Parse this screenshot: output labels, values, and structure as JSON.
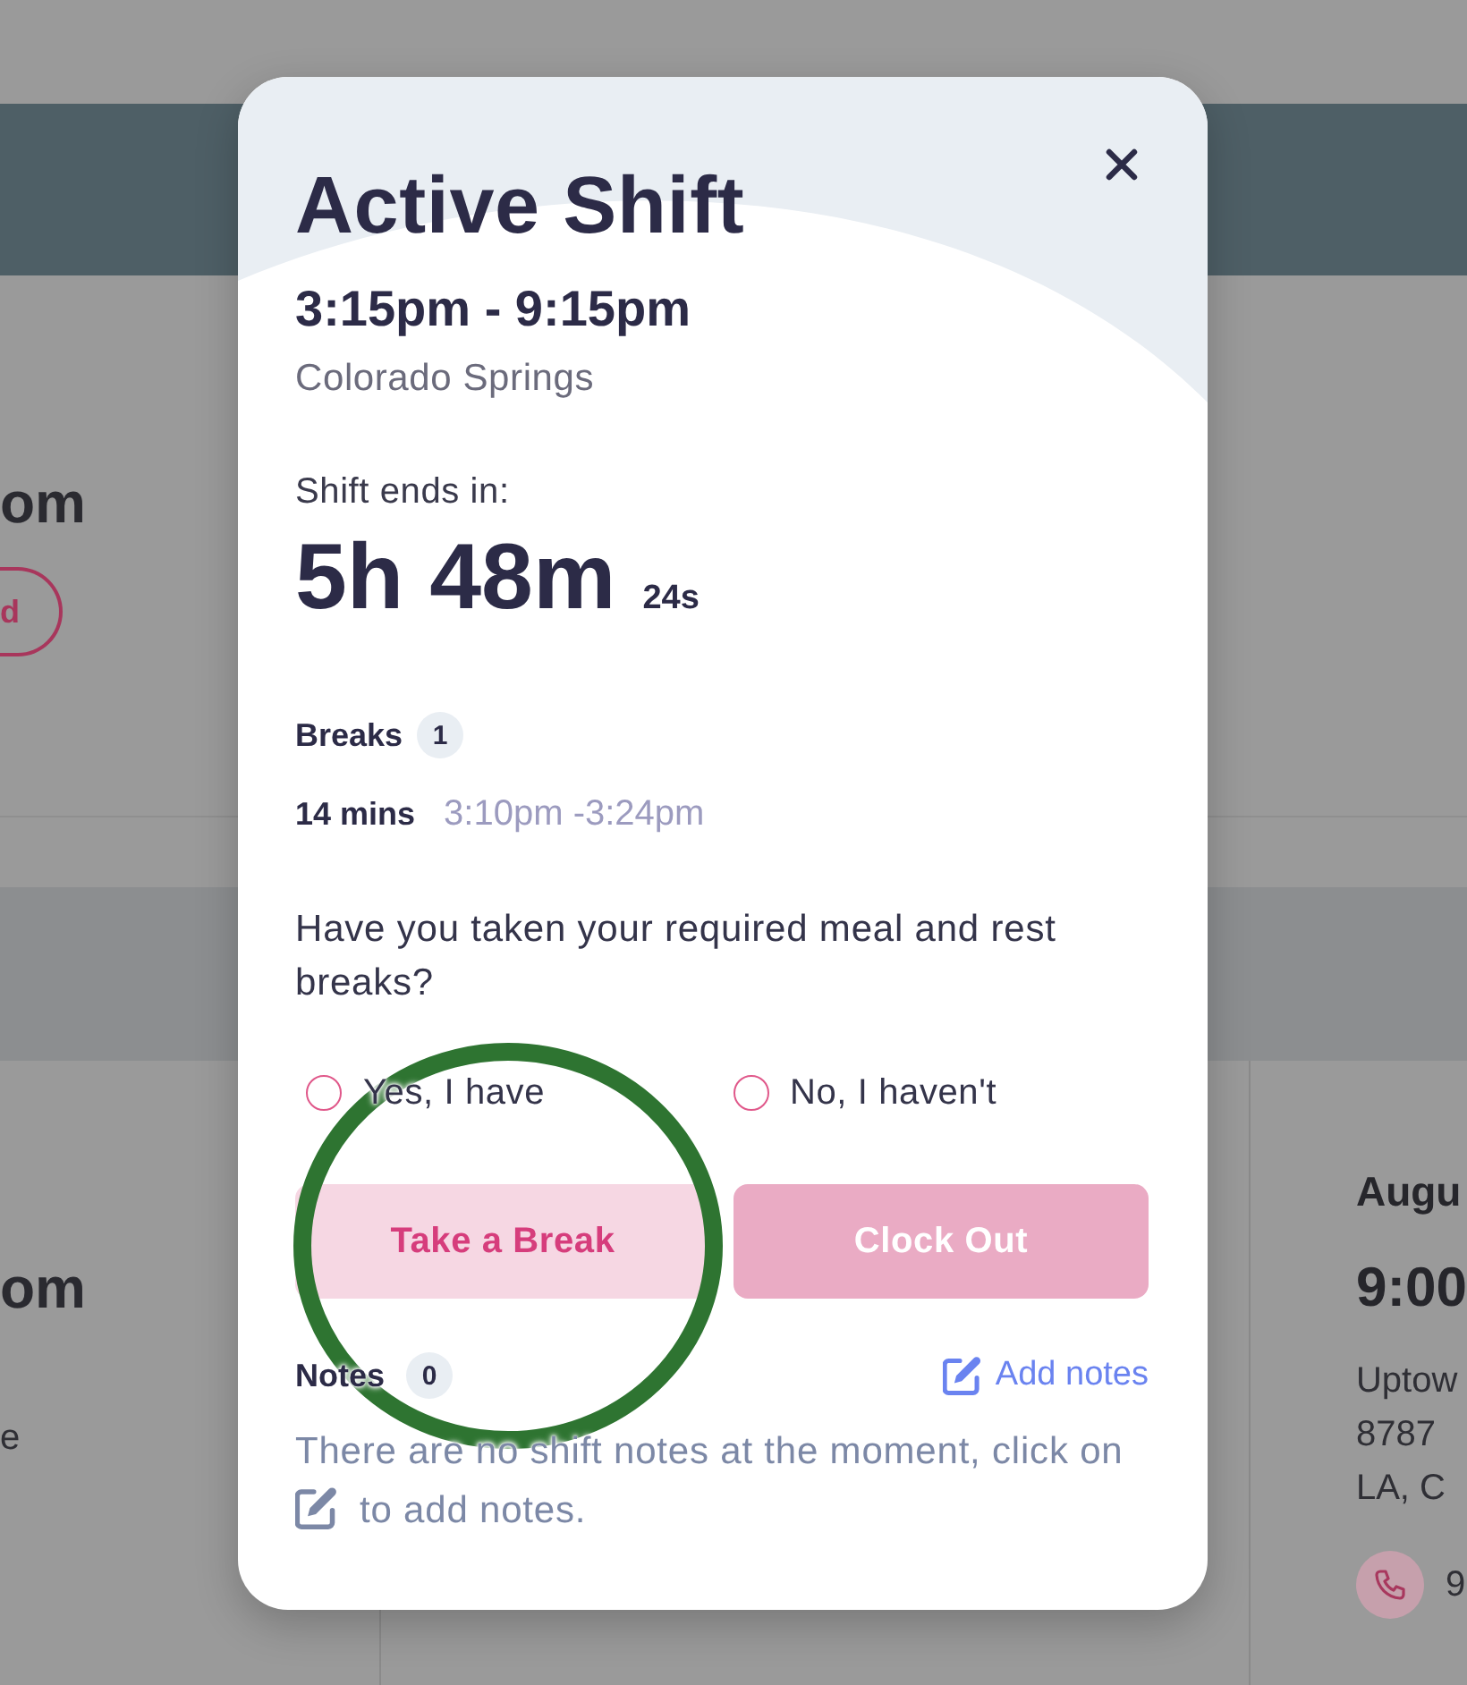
{
  "background": {
    "left_cards": [
      {
        "time": "om",
        "button": "d"
      },
      {
        "time": "om",
        "detail": "e"
      }
    ],
    "right_card": {
      "date": "Augu",
      "time": "9:00",
      "address_lines": [
        "Uptow",
        "8787",
        "LA, C"
      ],
      "phone": "9"
    }
  },
  "dialog": {
    "title": "Active Shift",
    "time_range": "3:15pm - 9:15pm",
    "location": "Colorado Springs",
    "countdown": {
      "label": "Shift ends in:",
      "value": "5h 48m",
      "seconds": "24s"
    },
    "breaks": {
      "label": "Breaks",
      "count": "1",
      "items": [
        {
          "duration": "14 mins",
          "time_range": "3:10pm -3:24pm"
        }
      ]
    },
    "question": "Have you taken your required meal and rest breaks?",
    "options": [
      {
        "label": "Yes, I have",
        "selected": false
      },
      {
        "label": "No, I haven't",
        "selected": false
      }
    ],
    "buttons": [
      {
        "label": "Take a Break",
        "kind": "secondary",
        "disabled": false
      },
      {
        "label": "Clock Out",
        "kind": "primary",
        "disabled": true
      }
    ],
    "notes": {
      "label": "Notes",
      "count": "0",
      "add_label": "Add notes",
      "empty_before": "There are no shift notes at the moment, click on",
      "empty_after": "to add notes."
    }
  },
  "annotation": {
    "kind": "circle"
  }
}
